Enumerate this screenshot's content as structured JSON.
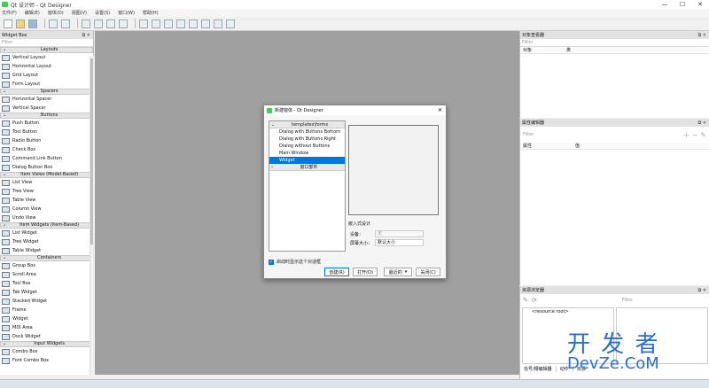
{
  "window": {
    "title": "Qt 设计师 - Qt Designer",
    "minimize": "—",
    "maximize": "☐",
    "close": "✕"
  },
  "menu": [
    "文件(F)",
    "编辑(E)",
    "窗体(O)",
    "视图(V)",
    "设置(S)",
    "窗口(W)",
    "帮助(H)"
  ],
  "widget_box": {
    "title": "Widget Box",
    "filter_placeholder": "Filter",
    "sections": [
      {
        "category": "Layouts",
        "items": [
          "Vertical Layout",
          "Horizontal Layout",
          "Grid Layout",
          "Form Layout"
        ]
      },
      {
        "category": "Spacers",
        "items": [
          "Horizontal Spacer",
          "Vertical Spacer"
        ]
      },
      {
        "category": "Buttons",
        "items": [
          "Push Button",
          "Tool Button",
          "Radio Button",
          "Check Box",
          "Command Link Button",
          "Dialog Button Box"
        ]
      },
      {
        "category": "Item Views (Model-Based)",
        "items": [
          "List View",
          "Tree View",
          "Table View",
          "Column View",
          "Undo View"
        ]
      },
      {
        "category": "Item Widgets (Item-Based)",
        "items": [
          "List Widget",
          "Tree Widget",
          "Table Widget"
        ]
      },
      {
        "category": "Containers",
        "items": [
          "Group Box",
          "Scroll Area",
          "Tool Box",
          "Tab Widget",
          "Stacked Widget",
          "Frame",
          "Widget",
          "MDI Area",
          "Dock Widget"
        ]
      },
      {
        "category": "Input Widgets",
        "items": [
          "Combo Box",
          "Font Combo Box"
        ]
      }
    ]
  },
  "object_inspector": {
    "title": "对象查看器",
    "filter_placeholder": "Filter",
    "col_object": "对象",
    "col_class": "类"
  },
  "property_editor": {
    "title": "属性编辑器",
    "filter_placeholder": "Filter",
    "col_property": "属性",
    "col_value": "值"
  },
  "resource_browser": {
    "title": "资源浏览器",
    "filter_placeholder": "Filter",
    "root": "<resource root>",
    "tabs": [
      "信号/槽编辑器",
      "动作",
      "资源"
    ]
  },
  "dialog": {
    "title": "新建窗体 - Qt Designer",
    "close": "✕",
    "tree": {
      "category": "templates\\forms",
      "items": [
        "Dialog with Buttons Bottom",
        "Dialog with Buttons Right",
        "Dialog without Buttons",
        "Main Window",
        "Widget"
      ],
      "selected_index": 4,
      "second_category": "窗口部件"
    },
    "embedded": {
      "title": "嵌入式设计",
      "device_label": "设备：",
      "device_value": "无",
      "screen_label": "屏幕大小：",
      "screen_value": "默认大小"
    },
    "show_on_startup": "启动时显示这个对话框",
    "buttons": {
      "create": "创建(R)",
      "open": "打开(O)",
      "recent": "最近的",
      "close": "关闭(C)"
    }
  },
  "watermark": {
    "line1": "开 发 者",
    "line2": "DevZe.CoM"
  },
  "colors": {
    "canvas": "#a0a0a0",
    "selection": "#0078d7",
    "qt_green": "#41cd52"
  }
}
